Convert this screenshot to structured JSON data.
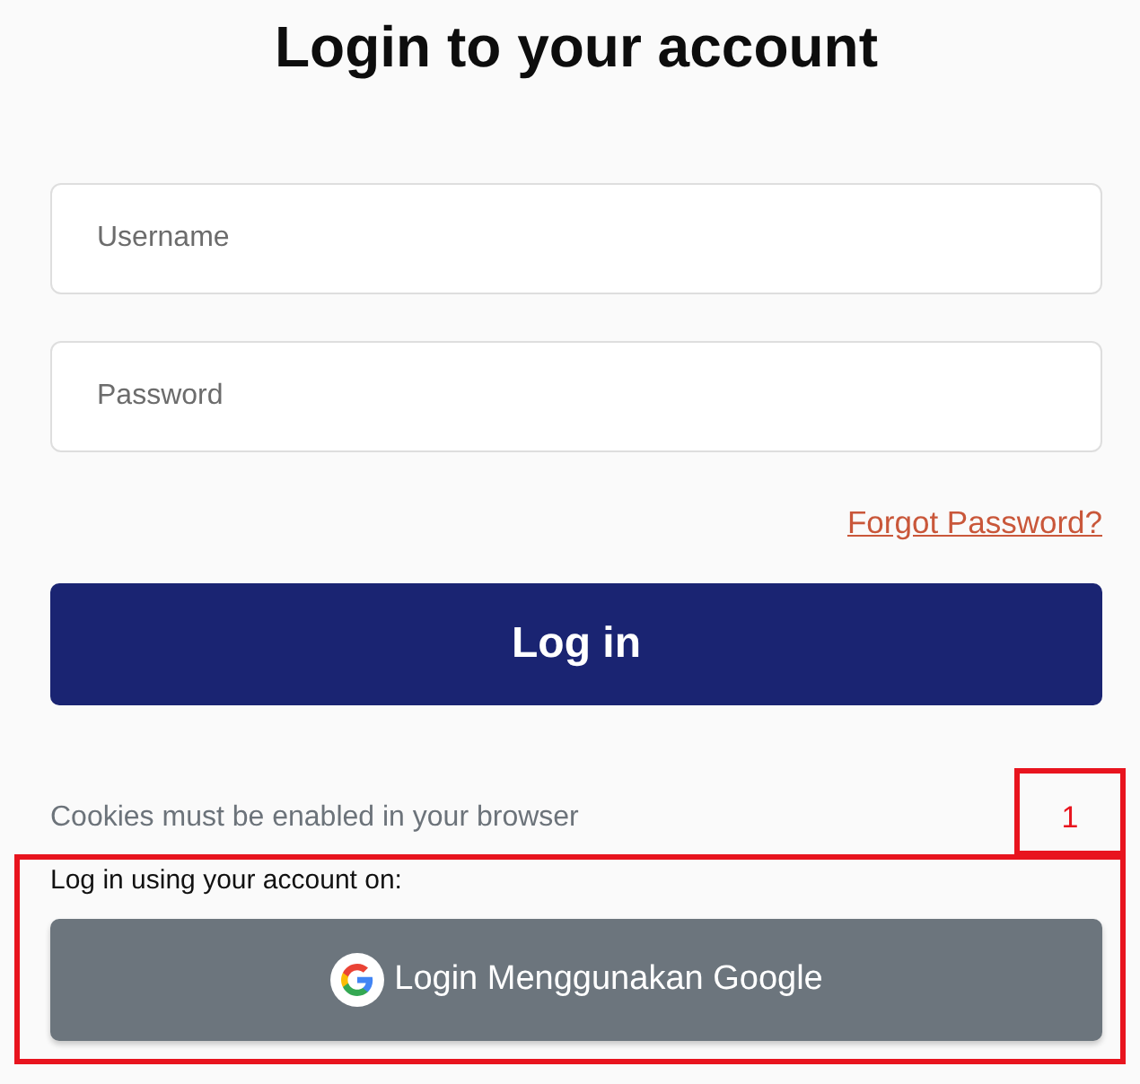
{
  "title": "Login to your account",
  "username_field": {
    "placeholder": "Username"
  },
  "password_field": {
    "placeholder": "Password"
  },
  "forgot_password_link": "Forgot Password?",
  "login_button": "Log in",
  "cookies_notice": "Cookies must be enabled in your browser",
  "alt_login": {
    "label": "Log in using your account on:",
    "google_button": "Login Menggunakan Google"
  },
  "annotations": [
    {
      "kind": "numbered",
      "label": "1"
    },
    {
      "kind": "frame"
    }
  ]
}
